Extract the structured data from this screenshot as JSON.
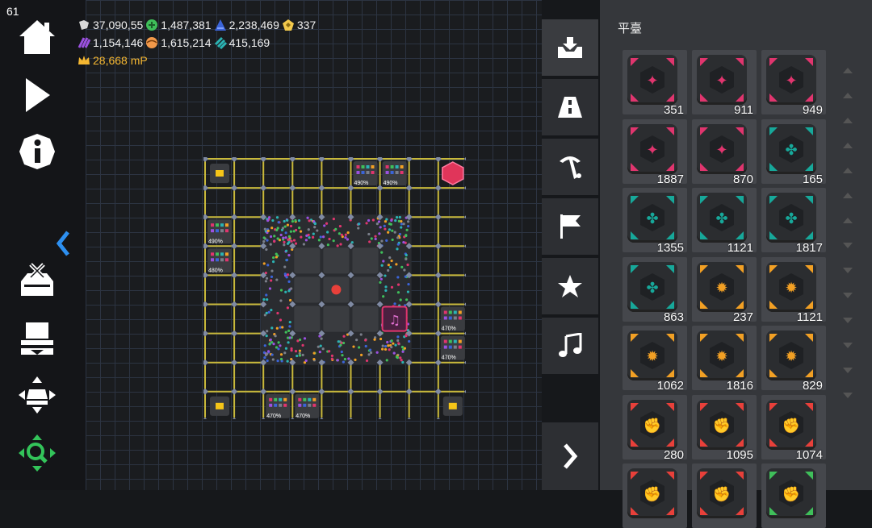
{
  "fps": "61",
  "resources": {
    "row1": [
      {
        "icon": "gem-cluster-icon",
        "value": "37,090,55",
        "color": "#d8d8d8"
      },
      {
        "icon": "green-orb-icon",
        "value": "1,487,381",
        "color": "#3fbf5a"
      },
      {
        "icon": "blue-wedge-icon",
        "value": "2,238,469",
        "color": "#3b64d8"
      },
      {
        "icon": "yellow-pentagon-icon",
        "value": "337",
        "color": "#f2c94c"
      }
    ],
    "row2": [
      {
        "icon": "purple-stripes-icon",
        "value": "1,154,146",
        "color": "#9b51e0"
      },
      {
        "icon": "orange-ball-icon",
        "value": "1,615,214",
        "color": "#f2994a"
      },
      {
        "icon": "teal-stripes-icon",
        "value": "415,169",
        "color": "#2bb3b3"
      }
    ],
    "mp": {
      "icon": "crown-icon",
      "value": "28,668 mP"
    }
  },
  "board_labels": [
    "490%",
    "490%",
    "490%",
    "480%",
    "470%",
    "470%",
    "470%",
    "470%"
  ],
  "panel": {
    "title": "平臺",
    "cards": [
      {
        "color": "#e0356e",
        "count": "351",
        "symbol": "✦"
      },
      {
        "color": "#e0356e",
        "count": "911",
        "symbol": "✦"
      },
      {
        "color": "#e0356e",
        "count": "949",
        "symbol": "✦"
      },
      {
        "color": "#e0356e",
        "count": "1887",
        "symbol": "✦"
      },
      {
        "color": "#e0356e",
        "count": "870",
        "symbol": "✦"
      },
      {
        "color": "#17a89a",
        "count": "165",
        "symbol": "✤"
      },
      {
        "color": "#17a89a",
        "count": "1355",
        "symbol": "✤"
      },
      {
        "color": "#17a89a",
        "count": "1121",
        "symbol": "✤"
      },
      {
        "color": "#17a89a",
        "count": "1817",
        "symbol": "✤"
      },
      {
        "color": "#17a89a",
        "count": "863",
        "symbol": "✤"
      },
      {
        "color": "#f2a024",
        "count": "237",
        "symbol": "✹"
      },
      {
        "color": "#f2a024",
        "count": "1121",
        "symbol": "✹"
      },
      {
        "color": "#f2a024",
        "count": "1062",
        "symbol": "✹"
      },
      {
        "color": "#f2a024",
        "count": "1816",
        "symbol": "✹"
      },
      {
        "color": "#f2a024",
        "count": "829",
        "symbol": "✹"
      },
      {
        "color": "#e8403a",
        "count": "280",
        "symbol": "✊"
      },
      {
        "color": "#e8403a",
        "count": "1095",
        "symbol": "✊"
      },
      {
        "color": "#e8403a",
        "count": "1074",
        "symbol": "✊"
      },
      {
        "color": "#e8403a",
        "count": "",
        "symbol": "✊"
      },
      {
        "color": "#e8403a",
        "count": "",
        "symbol": "✊"
      },
      {
        "color": "#3fbf5a",
        "count": "",
        "symbol": "✊"
      }
    ]
  },
  "colors": {
    "grid_line": "#c9b93a",
    "node": "#7f8aa3",
    "accent_blue": "#2d8ff0",
    "green": "#33c45a"
  }
}
